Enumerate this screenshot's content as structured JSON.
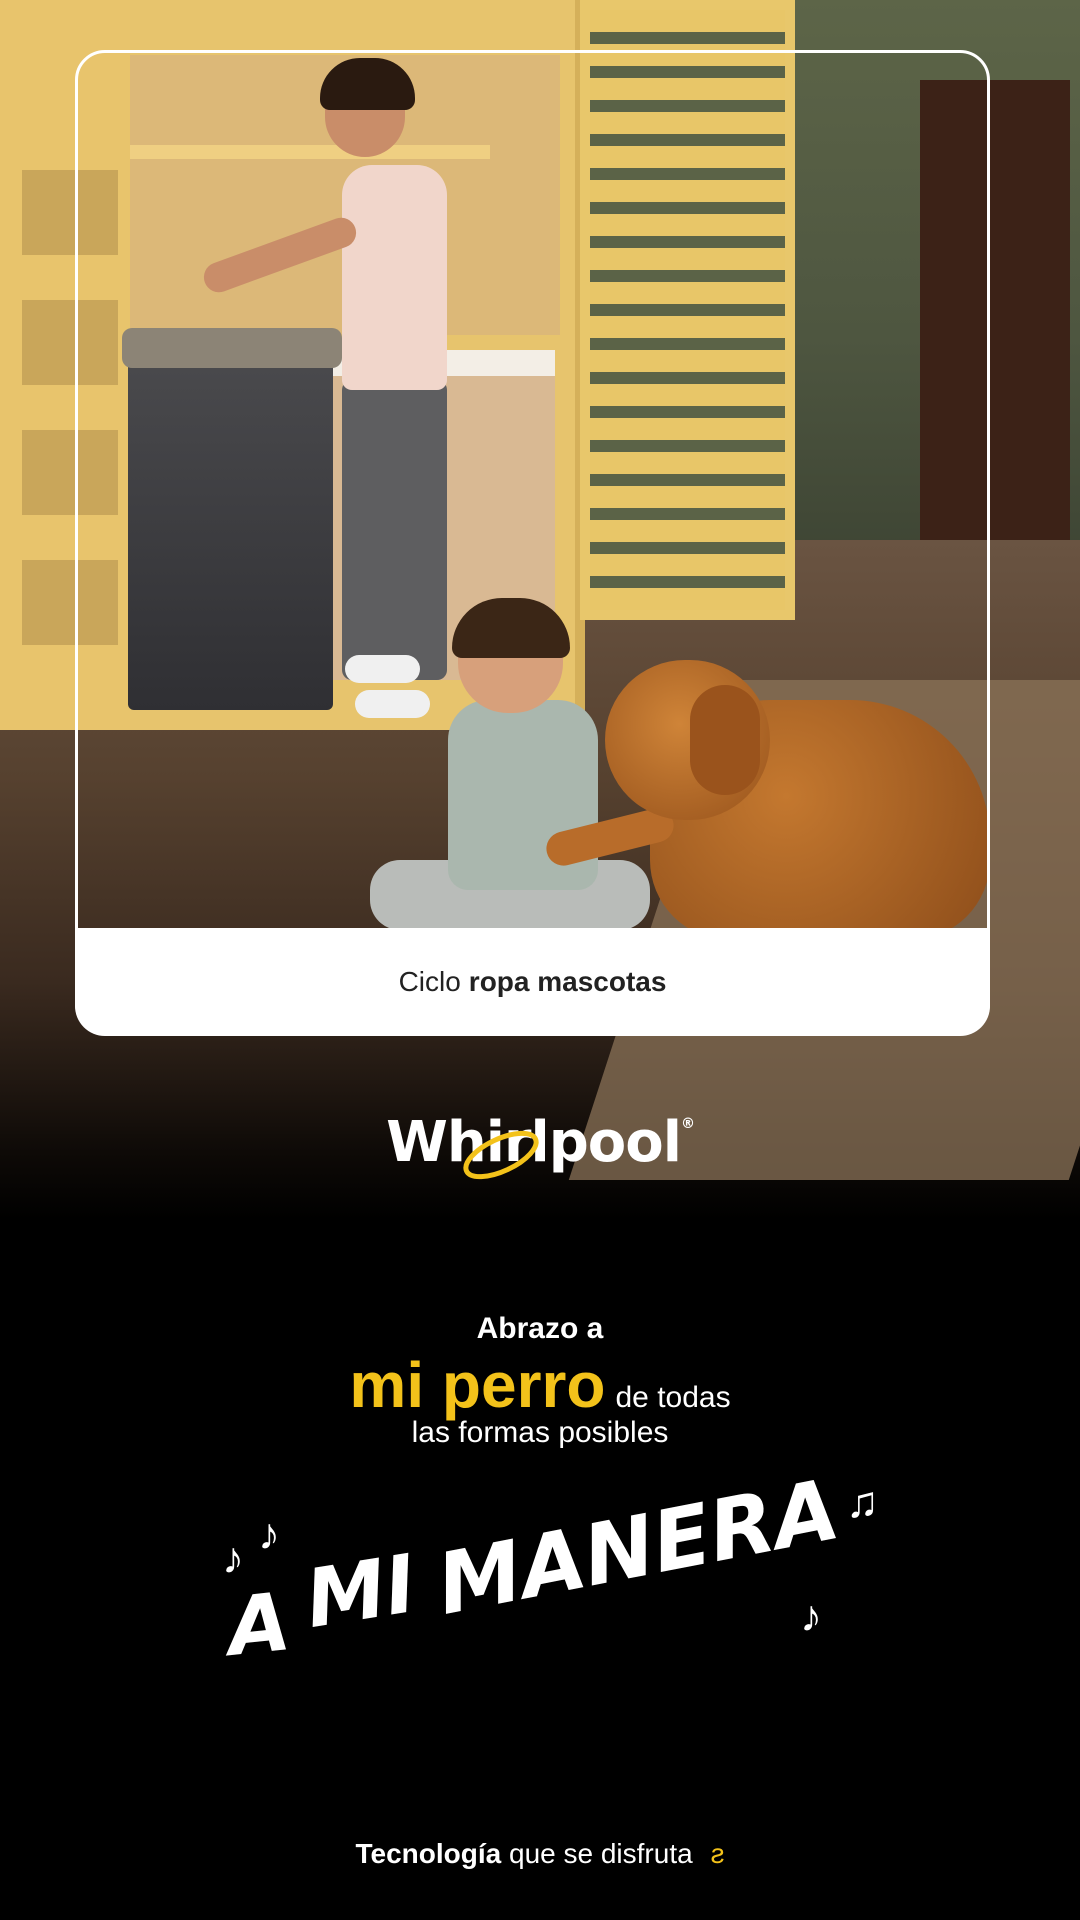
{
  "caption": {
    "prefix": "Ciclo",
    "bold": "ropa mascotas"
  },
  "logo": {
    "text": "Whirlpool",
    "reg": "®"
  },
  "headline": {
    "line1": "Abrazo a",
    "highlight": "mi perro",
    "line2_rest": "de todas",
    "line3": "las formas posibles"
  },
  "slogan": {
    "word1": "A",
    "word2": "MI",
    "word3": "MANERA"
  },
  "footer": {
    "bold": "Tecnología",
    "rest": "que se disfruta"
  },
  "colors": {
    "accent": "#f3c21a",
    "background": "#000000",
    "text": "#ffffff"
  }
}
